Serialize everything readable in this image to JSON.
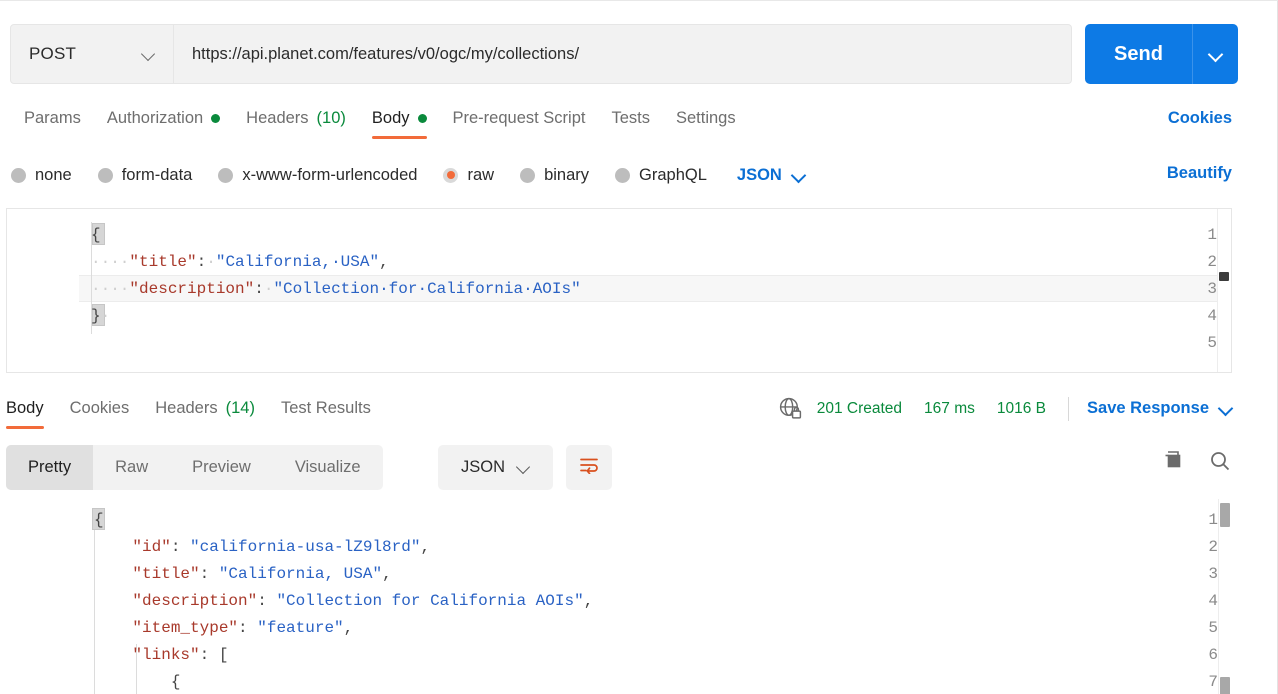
{
  "request": {
    "method": "POST",
    "method_icon": "chevron-down-icon",
    "url": "https://api.planet.com/features/v0/ogc/my/collections/",
    "send_label": "Send",
    "send_caret_icon": "chevron-down-icon",
    "tabs": [
      {
        "label": "Params",
        "badge": "",
        "dot": false,
        "active": false
      },
      {
        "label": "Authorization",
        "badge": "",
        "dot": true,
        "active": false
      },
      {
        "label": "Headers",
        "badge": "(10)",
        "dot": false,
        "active": false
      },
      {
        "label": "Body",
        "badge": "",
        "dot": true,
        "active": true
      },
      {
        "label": "Pre-request Script",
        "badge": "",
        "dot": false,
        "active": false
      },
      {
        "label": "Tests",
        "badge": "",
        "dot": false,
        "active": false
      },
      {
        "label": "Settings",
        "badge": "",
        "dot": false,
        "active": false
      }
    ],
    "cookies_link": "Cookies",
    "body_types": [
      {
        "label": "none",
        "selected": false
      },
      {
        "label": "form-data",
        "selected": false
      },
      {
        "label": "x-www-form-urlencoded",
        "selected": false
      },
      {
        "label": "raw",
        "selected": true
      },
      {
        "label": "binary",
        "selected": false
      },
      {
        "label": "GraphQL",
        "selected": false
      }
    ],
    "raw_format": "JSON",
    "raw_format_icon": "chevron-down-icon",
    "beautify_link": "Beautify",
    "body_lines": [
      {
        "num": "1",
        "text": "{"
      },
      {
        "num": "2",
        "text": "    \"title\": \"California, USA\","
      },
      {
        "num": "3",
        "text": "    \"description\": \"Collection for California AOIs\""
      },
      {
        "num": "4",
        "text": "}"
      },
      {
        "num": "5",
        "text": ""
      }
    ]
  },
  "response": {
    "tabs": [
      {
        "label": "Body",
        "badge": "",
        "active": true
      },
      {
        "label": "Cookies",
        "badge": "",
        "active": false
      },
      {
        "label": "Headers",
        "badge": "(14)",
        "active": false
      },
      {
        "label": "Test Results",
        "badge": "",
        "active": false
      }
    ],
    "security_icon": "globe-lock-icon",
    "status": "201 Created",
    "time": "167 ms",
    "size": "1016 B",
    "save_response": "Save Response",
    "save_response_icon": "chevron-down-icon",
    "view_tabs": [
      {
        "label": "Pretty",
        "active": true
      },
      {
        "label": "Raw",
        "active": false
      },
      {
        "label": "Preview",
        "active": false
      },
      {
        "label": "Visualize",
        "active": false
      }
    ],
    "format": "JSON",
    "format_icon": "chevron-down-icon",
    "wrap_icon": "word-wrap-icon",
    "copy_icon": "copy-icon",
    "search_icon": "search-icon",
    "body_lines": [
      {
        "num": "1",
        "text": "{"
      },
      {
        "num": "2",
        "text": "    \"id\": \"california-usa-lZ9l8rd\","
      },
      {
        "num": "3",
        "text": "    \"title\": \"California, USA\","
      },
      {
        "num": "4",
        "text": "    \"description\": \"Collection for California AOIs\","
      },
      {
        "num": "5",
        "text": "    \"item_type\": \"feature\","
      },
      {
        "num": "6",
        "text": "    \"links\": ["
      },
      {
        "num": "7",
        "text": "        {"
      }
    ]
  },
  "colors": {
    "accent_orange": "#f26b3a",
    "link_blue": "#0b6fd4",
    "send_blue": "#0d7ae5",
    "success_green": "#0a8a3c",
    "json_key": "#a8392b",
    "json_string": "#2a62c4"
  }
}
